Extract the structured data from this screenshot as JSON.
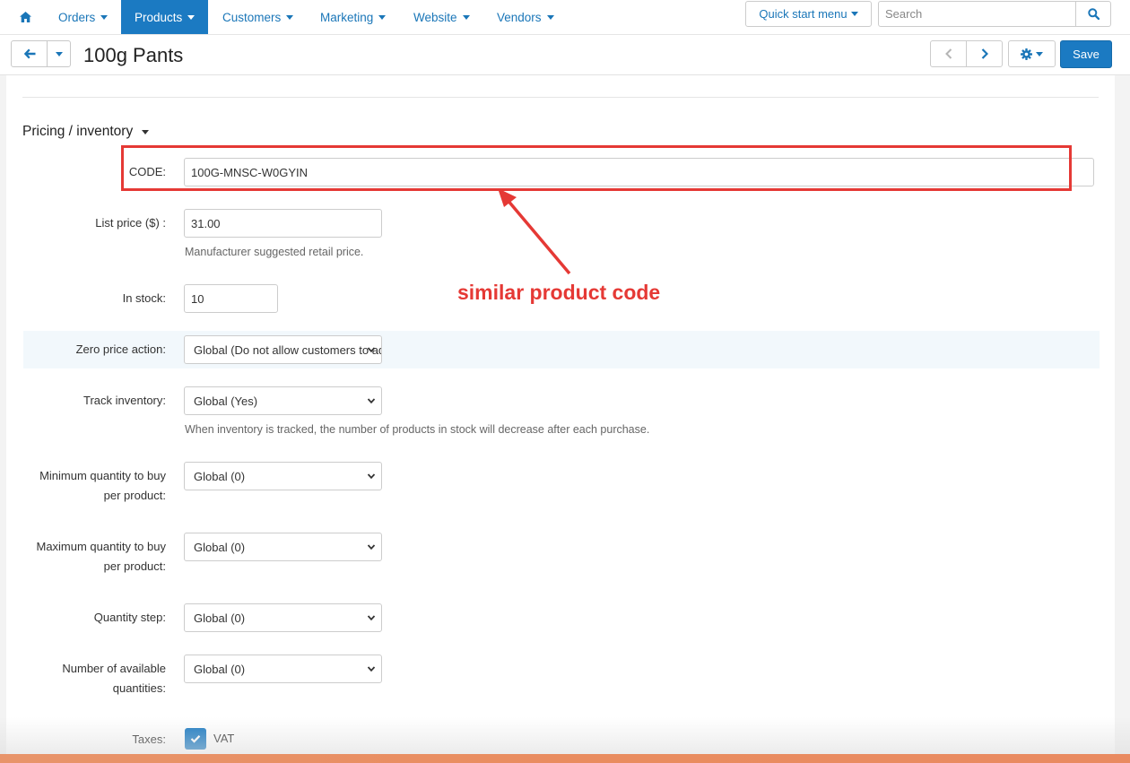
{
  "nav": {
    "items": [
      {
        "label": "Orders"
      },
      {
        "label": "Products"
      },
      {
        "label": "Customers"
      },
      {
        "label": "Marketing"
      },
      {
        "label": "Website"
      },
      {
        "label": "Vendors"
      }
    ],
    "quick_start_label": "Quick start menu",
    "search_placeholder": "Search"
  },
  "titlebar": {
    "title": "100g Pants",
    "save_label": "Save"
  },
  "section": {
    "title": "Pricing / inventory"
  },
  "form": {
    "code": {
      "label": "CODE:",
      "value": "100G-MNSC-W0GYIN"
    },
    "list_price": {
      "label": "List price ($) :",
      "value": "31.00",
      "help": "Manufacturer suggested retail price."
    },
    "in_stock": {
      "label": "In stock:",
      "value": "10"
    },
    "zero_price_action": {
      "label": "Zero price action:",
      "value": "Global (Do not allow customers to add the product to cart)"
    },
    "track_inventory": {
      "label": "Track inventory:",
      "value": "Global (Yes)",
      "help": "When inventory is tracked, the number of products in stock will decrease after each purchase."
    },
    "min_qty": {
      "label_line1": "Minimum quantity to buy",
      "label_line2": "per product:",
      "value": "Global (0)"
    },
    "max_qty": {
      "label_line1": "Maximum quantity to buy",
      "label_line2": "per product:",
      "value": "Global (0)"
    },
    "qty_step": {
      "label": "Quantity step:",
      "value": "Global (0)"
    },
    "available_qty": {
      "label_line1": "Number of available",
      "label_line2": "quantities:",
      "value": "Global (0)"
    },
    "taxes": {
      "label": "Taxes:",
      "option": "VAT",
      "checked": true
    }
  },
  "annotation": {
    "text": "similar product code",
    "color": "#e53935"
  },
  "colors": {
    "accent": "#1b7ac2",
    "link": "#1a76b8"
  }
}
